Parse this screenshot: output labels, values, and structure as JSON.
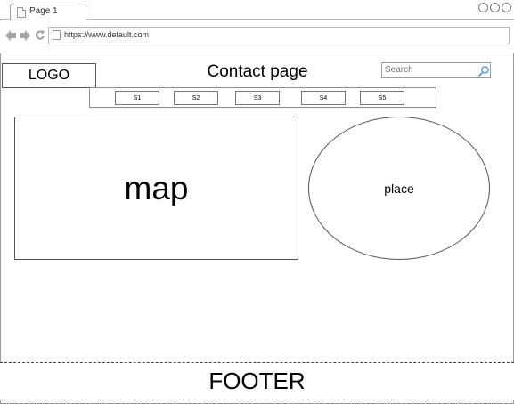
{
  "browser": {
    "tab_label": "Page 1",
    "url": "https://www.default.com",
    "icons": [
      "back-arrow-icon",
      "forward-arrow-icon",
      "refresh-icon",
      "page-icon"
    ]
  },
  "header": {
    "logo": "LOGO",
    "title": "Contact page",
    "search_placeholder": "Search"
  },
  "nav": {
    "items": [
      {
        "label": "S1"
      },
      {
        "label": "S2"
      },
      {
        "label": "S3"
      },
      {
        "label": "S4"
      },
      {
        "label": "S5"
      }
    ]
  },
  "main": {
    "map_label": "map",
    "place_label": "place"
  },
  "footer": {
    "label": "FOOTER"
  }
}
